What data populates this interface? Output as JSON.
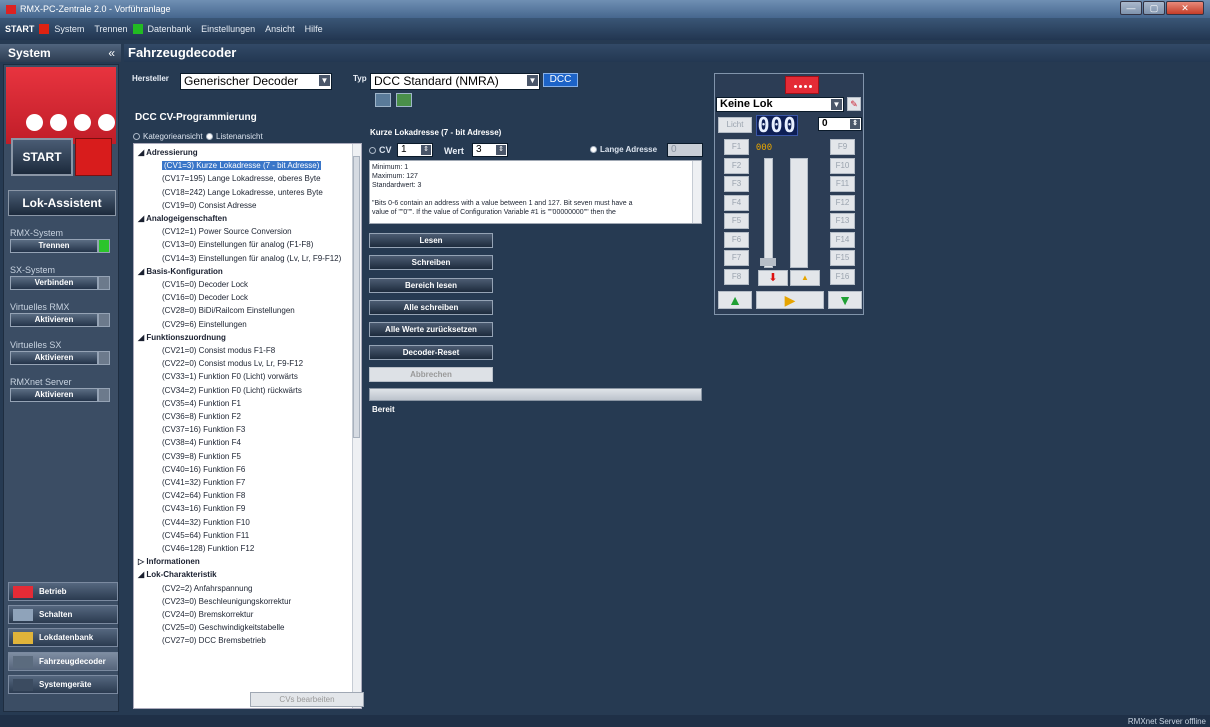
{
  "window": {
    "title": "RMX-PC-Zentrale 2.0 - Vorführanlage",
    "buttons": [
      "—",
      "▢",
      "✕"
    ]
  },
  "menu": {
    "start": "START",
    "system": "System",
    "trennen": "Trennen",
    "datenbank": "Datenbank",
    "einstellungen": "Einstellungen",
    "ansicht": "Ansicht",
    "hilfe": "Hilfe"
  },
  "sidebar": {
    "title": "System",
    "collapse": "«",
    "start": "START",
    "lok_assistent": "Lok-Assistent",
    "groups": [
      {
        "label": "RMX-System",
        "button": "Trennen",
        "active": true
      },
      {
        "label": "SX-System",
        "button": "Verbinden",
        "active": false
      },
      {
        "label": "Virtuelles RMX",
        "button": "Aktivieren",
        "active": false
      },
      {
        "label": "Virtuelles SX",
        "button": "Aktivieren",
        "active": false
      },
      {
        "label": "RMXnet Server",
        "button": "Aktivieren",
        "active": false
      }
    ],
    "nav": [
      {
        "label": "Betrieb",
        "icon": "betrieb-icon"
      },
      {
        "label": "Schalten",
        "icon": "schalten-icon"
      },
      {
        "label": "Lokdatenbank",
        "icon": "lokdatenbank-icon"
      },
      {
        "label": "Fahrzeugdecoder",
        "icon": "fahrzeugdecoder-icon"
      },
      {
        "label": "Systemgeräte",
        "icon": "systemgeraete-icon"
      }
    ]
  },
  "main": {
    "title": "Fahrzeugdecoder",
    "hersteller_label": "Hersteller",
    "hersteller_value": "Generischer Decoder",
    "typ_label": "Typ",
    "typ_value": "DCC Standard (NMRA)",
    "typ_badge": "DCC",
    "section_title": "DCC CV-Programmierung",
    "view_kategorie": "Kategorieansicht",
    "view_liste": "Listenansicht",
    "cv_button": "CVs bearbeiten"
  },
  "tree": {
    "groups": [
      {
        "label": "Adressierung",
        "expanded": true,
        "items": [
          "(CV1=3) Kurze Lokadresse (7 - bit Adresse)",
          "(CV17=195) Lange Lokadresse, oberes Byte",
          "(CV18=242) Lange Lokadresse, unteres Byte",
          "(CV19=0) Consist Adresse"
        ]
      },
      {
        "label": "Analogeigenschaften",
        "expanded": true,
        "items": [
          "(CV12=1) Power Source Conversion",
          "(CV13=0) Einstellungen für analog (F1-F8)",
          "(CV14=3) Einstellungen für analog (Lv, Lr, F9-F12)"
        ]
      },
      {
        "label": "Basis-Konfiguration",
        "expanded": true,
        "items": [
          "(CV15=0) Decoder Lock",
          "(CV16=0) Decoder Lock",
          "(CV28=0) BiDi/Railcom Einstellungen",
          "(CV29=6) Einstellungen"
        ]
      },
      {
        "label": "Funktionszuordnung",
        "expanded": true,
        "items": [
          "(CV21=0) Consist modus F1-F8",
          "(CV22=0) Consist modus Lv, Lr, F9-F12",
          "(CV33=1) Funktion F0 (Licht) vorwärts",
          "(CV34=2) Funktion F0 (Licht) rückwärts",
          "(CV35=4) Funktion F1",
          "(CV36=8) Funktion F2",
          "(CV37=16) Funktion F3",
          "(CV38=4) Funktion F4",
          "(CV39=8) Funktion F5",
          "(CV40=16) Funktion F6",
          "(CV41=32) Funktion F7",
          "(CV42=64) Funktion F8",
          "(CV43=16) Funktion F9",
          "(CV44=32) Funktion F10",
          "(CV45=64) Funktion F11",
          "(CV46=128) Funktion F12"
        ]
      },
      {
        "label": "Informationen",
        "expanded": false,
        "items": []
      },
      {
        "label": "Lok-Charakteristik",
        "expanded": true,
        "items": [
          "(CV2=2) Anfahrspannung",
          "(CV23=0) Beschleunigungskorrektur",
          "(CV24=0) Bremskorrektur",
          "(CV25=0) Geschwindigkeitstabelle",
          "(CV27=0) DCC Bremsbetrieb"
        ]
      }
    ]
  },
  "detail": {
    "title": "Kurze Lokadresse (7 - bit Adresse)",
    "cv_label": "CV",
    "cv_value": "1",
    "wert_label": "Wert",
    "wert_value": "3",
    "lange_label": "Lange Adresse",
    "lange_value": "0",
    "description_lines": [
      "Minimum: 1",
      "Maximum: 127",
      "Standardwert: 3",
      "",
      "\"Bits 0-6 contain an address with a value between 1 and 127. Bit seven must have a",
      "value of \"\"0\"\". If the value of Configuration Variable #1 is \"\"00000000\"\" then the"
    ],
    "buttons": [
      "Lesen",
      "Schreiben",
      "Bereich lesen",
      "Alle schreiben",
      "Alle Werte zurücksetzen",
      "Decoder-Reset"
    ],
    "abbrechen": "Abbrechen",
    "status": "Bereit"
  },
  "throttle": {
    "lok": "Keine Lok",
    "licht": "Licht",
    "speed_display": "000",
    "speed_small": "000",
    "step": "0",
    "fkeys_left": [
      "F1",
      "F2",
      "F3",
      "F4",
      "F5",
      "F6",
      "F7",
      "F8"
    ],
    "fkeys_right": [
      "F9",
      "F10",
      "F11",
      "F12",
      "F13",
      "F14",
      "F15",
      "F16"
    ],
    "speed_level": 0
  },
  "statusbar": "RMXnet Server offline"
}
